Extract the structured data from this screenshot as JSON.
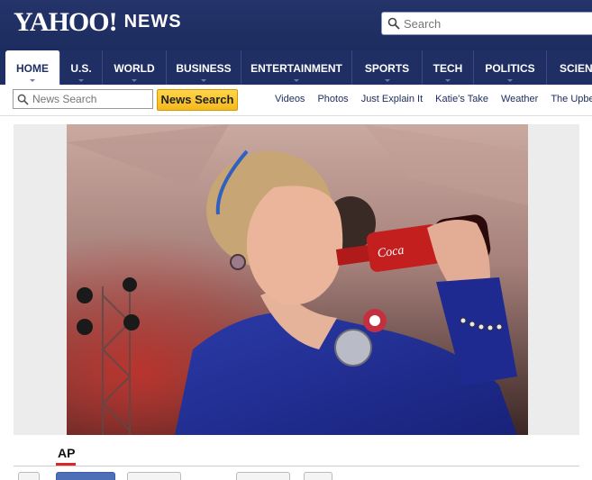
{
  "header": {
    "logo_text": "YAHOO!",
    "logo_sub": "NEWS",
    "search_placeholder": "Search"
  },
  "nav": {
    "items": [
      {
        "label": "HOME",
        "active": true
      },
      {
        "label": "U.S."
      },
      {
        "label": "WORLD"
      },
      {
        "label": "BUSINESS"
      },
      {
        "label": "ENTERTAINMENT"
      },
      {
        "label": "SPORTS"
      },
      {
        "label": "TECH"
      },
      {
        "label": "POLITICS"
      },
      {
        "label": "SCIENCE"
      }
    ]
  },
  "subbar": {
    "news_search_placeholder": "News Search",
    "news_search_button": "News Search",
    "links": [
      "Videos",
      "Photos",
      "Just Explain It",
      "Katie's Take",
      "Weather",
      "The Upbeat"
    ]
  },
  "photo": {
    "source": "AP"
  },
  "colors": {
    "masthead": "#24346a",
    "nav": "#1f2e63",
    "button": "#f5b81c",
    "accent_red": "#d52a2a"
  }
}
